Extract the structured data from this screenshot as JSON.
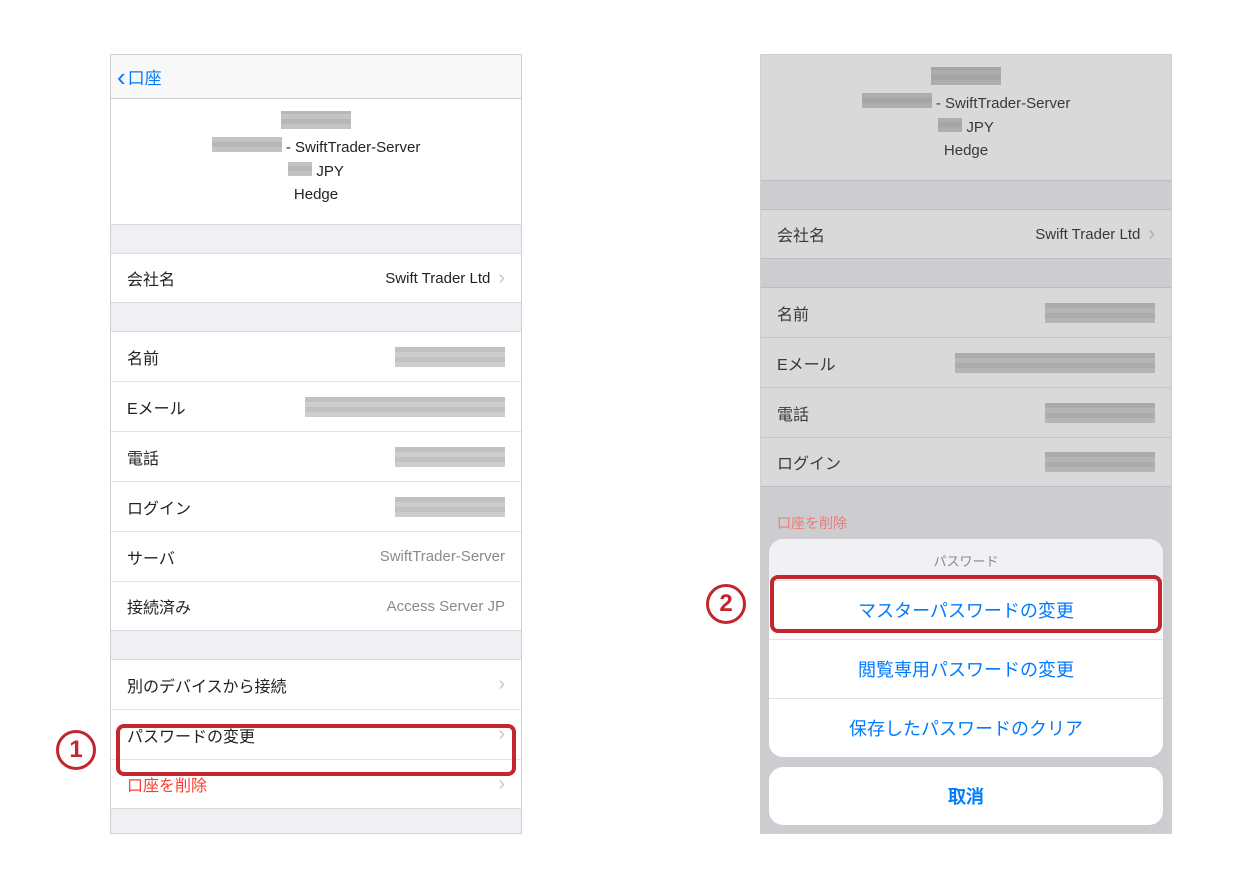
{
  "left": {
    "back_label": "口座",
    "header": {
      "server_suffix": "- SwiftTrader-Server",
      "currency": "JPY",
      "mode": "Hedge"
    },
    "company": {
      "label": "会社名",
      "value": "Swift Trader Ltd"
    },
    "fields": {
      "name": "名前",
      "email": "Eメール",
      "phone": "電話",
      "login": "ログイン",
      "server_label": "サーバ",
      "server_value": "SwiftTrader-Server",
      "connected_label": "接続済み",
      "connected_value": "Access Server JP"
    },
    "actions": {
      "connect_other": "別のデバイスから接続",
      "change_password": "パスワードの変更",
      "delete_account": "口座を削除"
    }
  },
  "right": {
    "header": {
      "server_suffix": "- SwiftTrader-Server",
      "currency": "JPY",
      "mode": "Hedge"
    },
    "company": {
      "label": "会社名",
      "value": "Swift Trader Ltd"
    },
    "fields": {
      "name": "名前",
      "email": "Eメール",
      "phone": "電話",
      "login": "ログイン"
    },
    "behind_delete": "口座を削除",
    "sheet": {
      "title": "パスワード",
      "change_master": "マスターパスワードの変更",
      "change_readonly": "閲覧専用パスワードの変更",
      "clear_saved": "保存したパスワードのクリア",
      "cancel": "取消"
    }
  },
  "callouts": {
    "one": "1",
    "two": "2"
  }
}
